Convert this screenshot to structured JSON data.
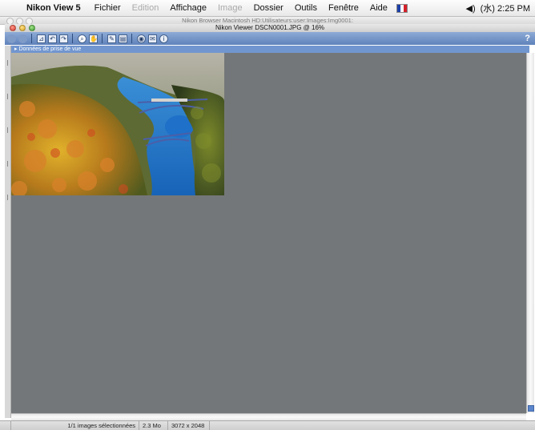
{
  "menubar": {
    "app": "Nikon View 5",
    "items": [
      {
        "label": "Fichier",
        "enabled": true
      },
      {
        "label": "Edition",
        "enabled": false
      },
      {
        "label": "Affichage",
        "enabled": true
      },
      {
        "label": "Image",
        "enabled": false
      },
      {
        "label": "Dossier",
        "enabled": true
      },
      {
        "label": "Outils",
        "enabled": true
      },
      {
        "label": "Fenêtre",
        "enabled": true
      },
      {
        "label": "Aide",
        "enabled": true
      }
    ],
    "clock": "(水) 2:25 PM"
  },
  "background_window": {
    "title": "Nikon Browser Macintosh HD:Utilisateurs:user:Images:Img0001:"
  },
  "window": {
    "title": "Nikon Viewer DSCN0001.JPG @ 16%"
  },
  "toolbar": {
    "help_label": "?",
    "icons": [
      "back-icon",
      "forward-icon",
      "crop-icon",
      "rotate-left-icon",
      "rotate-right-icon",
      "zoom-icon",
      "hand-icon",
      "edit-icon",
      "page-icon",
      "print-icon",
      "mail-icon",
      "info-icon"
    ]
  },
  "infobar": {
    "label": "Données de prise de vue"
  },
  "status": {
    "selection": "1/1 images sélectionnées",
    "size": "2.3 Mo",
    "dimensions": "3072 x 2048"
  },
  "colors": {
    "canvas": "#747779",
    "toolbar": "#6f90c6",
    "infobar": "#7196cf",
    "scroll_thumb": "#5b86cc"
  }
}
